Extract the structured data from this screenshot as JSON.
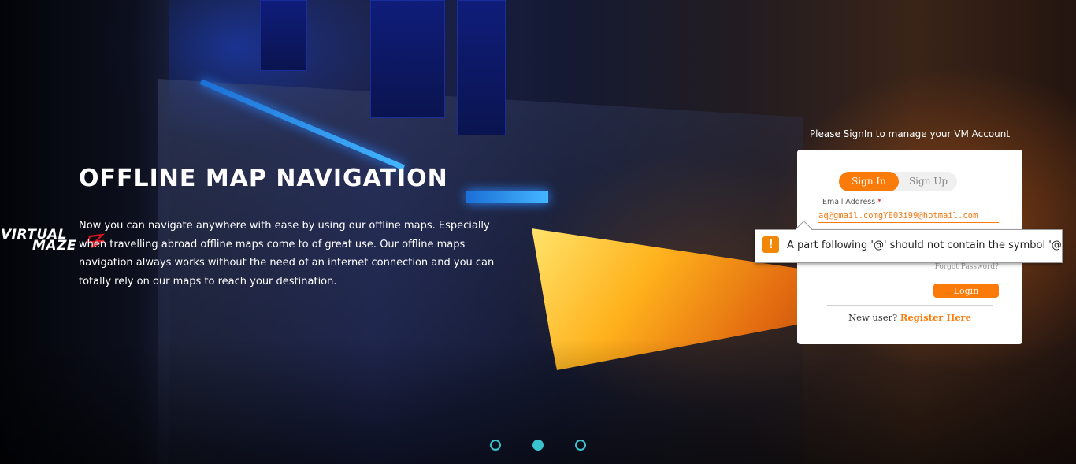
{
  "hero": {
    "title": "OFFLINE MAP NAVIGATION",
    "description": "Now you can navigate anywhere with ease by using our offline maps. Especially when travelling abroad offline maps come to of great use. Our offline maps navigation always works without the need of an internet connection and you can totally rely on our maps to reach your destination."
  },
  "logo": {
    "line1": "VIRTUAL",
    "line2": "MAZE",
    "accent_color": "#d8141c"
  },
  "signin": {
    "prompt": "Please SignIn to manage your VM Account",
    "tabs": [
      "Sign In",
      "Sign Up"
    ],
    "active_tab": "Sign In",
    "email_label": "Email Address",
    "required_marker": "*",
    "email_value": "aq@gmail.comgYE03i99@hotmail.com",
    "forgot_password": "Forgot Password?",
    "login_button": "Login",
    "new_user_text": "New user?",
    "register_link": "Register Here"
  },
  "validation_tooltip": {
    "icon": "warning-icon",
    "message": "A part following '@' should not contain the symbol '@'."
  },
  "carousel": {
    "slides": 3,
    "active_index": 1
  },
  "colors": {
    "accent": "#fb7b0a",
    "dot": "#39c3cf",
    "warning": "#f28705"
  }
}
